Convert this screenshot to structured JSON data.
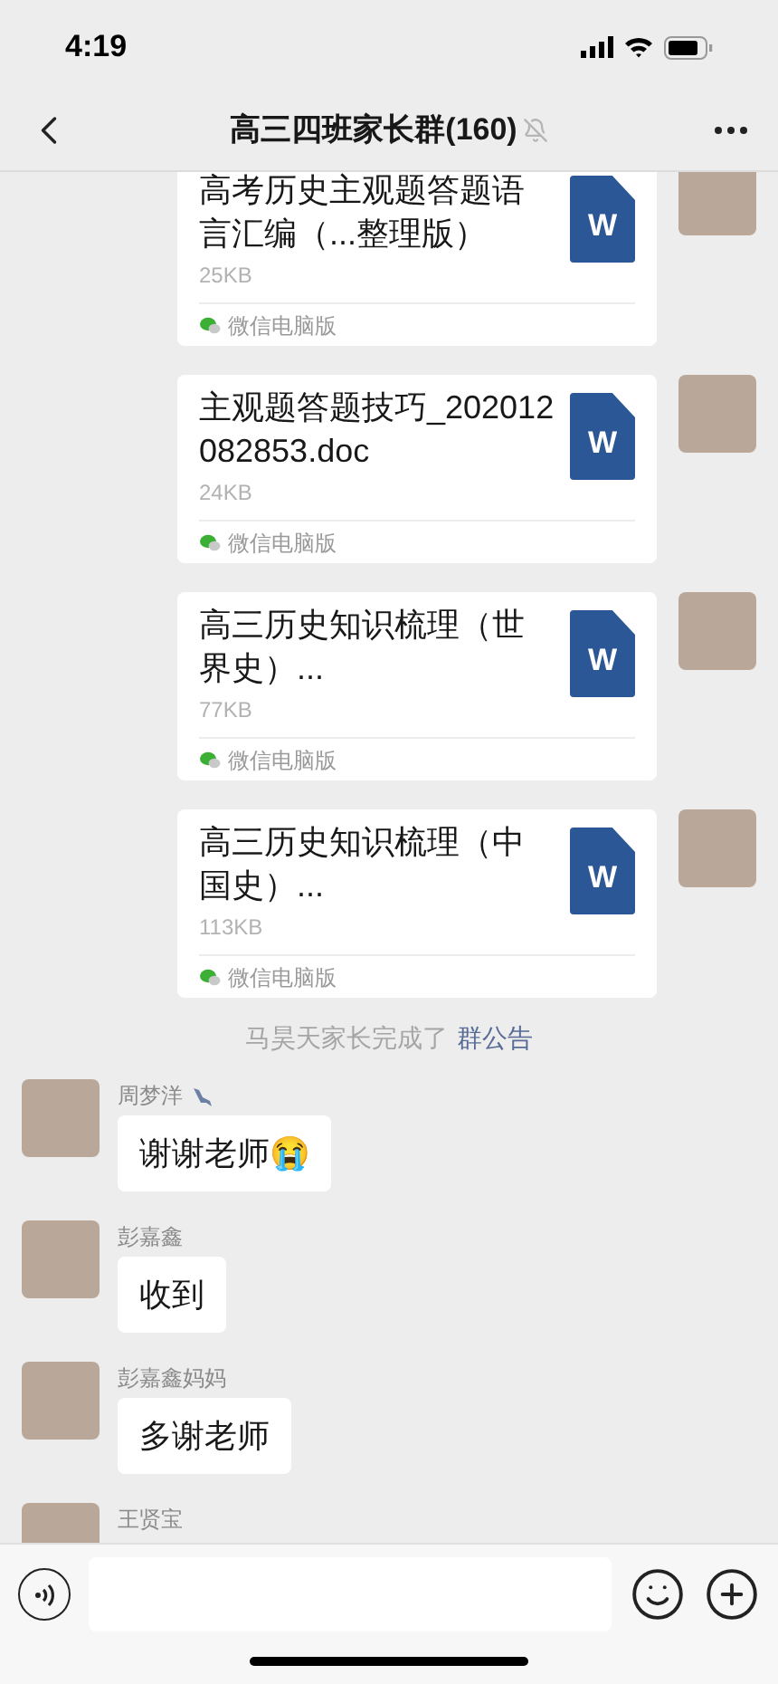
{
  "status_bar": {
    "time": "4:19"
  },
  "header": {
    "title": "高三四班家长群(160)",
    "muted": true
  },
  "files": [
    {
      "name": "高考历史主观题答题语言汇编（...整理版）",
      "size": "25KB",
      "source": "微信电脑版",
      "badge": "W"
    },
    {
      "name": "主观题答题技巧_202012082853.doc",
      "size": "24KB",
      "source": "微信电脑版",
      "badge": "W"
    },
    {
      "name": "高三历史知识梳理（世界史）...",
      "size": "77KB",
      "source": "微信电脑版",
      "badge": "W"
    },
    {
      "name": "高三历史知识梳理（中国史）...",
      "size": "113KB",
      "source": "微信电脑版",
      "badge": "W"
    }
  ],
  "system_notice": {
    "text": "马昊天家长完成了",
    "link": "群公告"
  },
  "messages": [
    {
      "sender": "周梦洋",
      "tag": true,
      "text": "谢谢老师😭"
    },
    {
      "sender": "彭嘉鑫",
      "tag": false,
      "text": "收到"
    },
    {
      "sender": "彭嘉鑫妈妈",
      "tag": false,
      "text": "多谢老师"
    },
    {
      "sender": "王贤宝",
      "tag": false
    }
  ]
}
